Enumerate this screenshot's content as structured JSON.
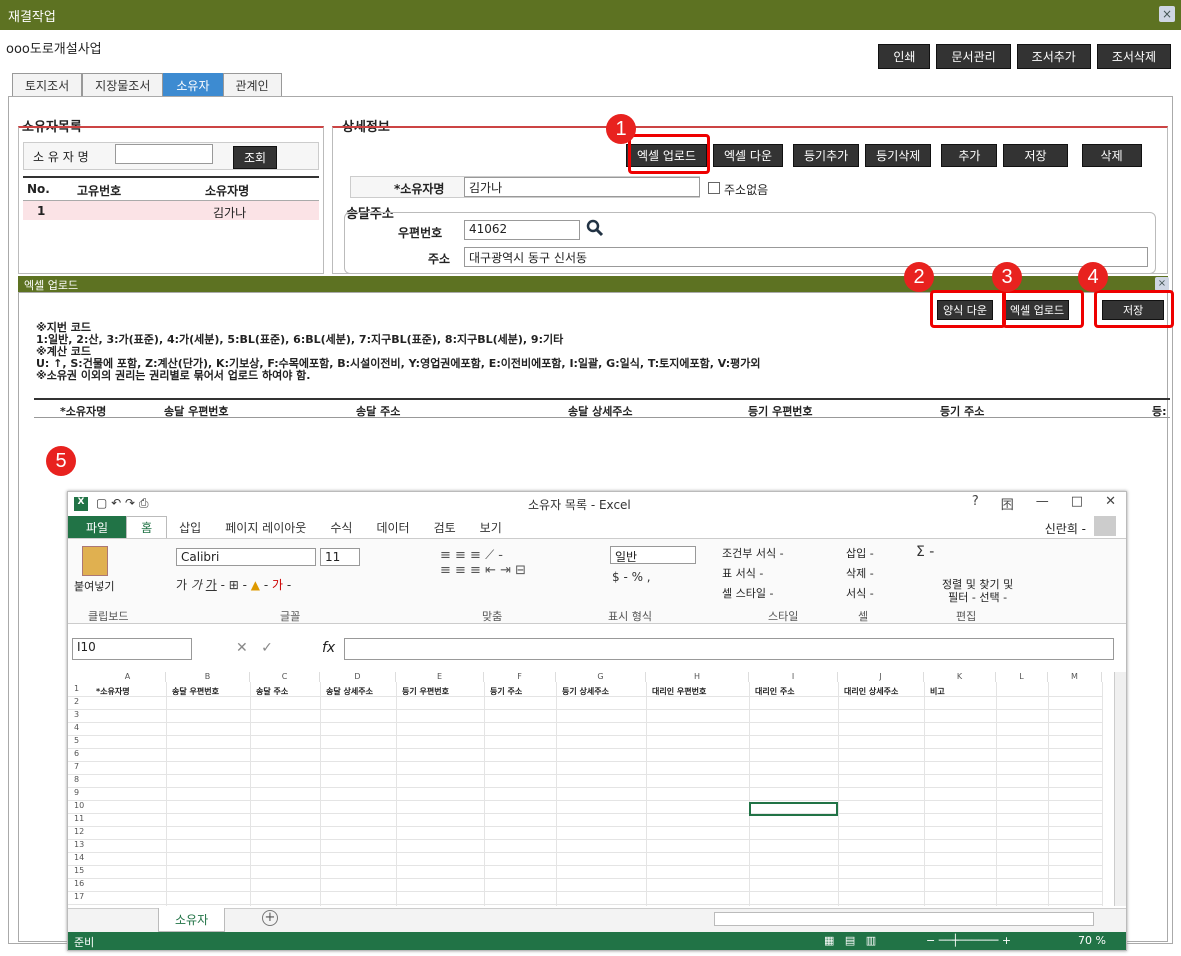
{
  "window": {
    "title": "재결작업",
    "close": "×"
  },
  "project": "ooo도로개설사업",
  "top_buttons": [
    "인쇄",
    "문서관리",
    "조서추가",
    "조서삭제"
  ],
  "tabs": [
    "토지조서",
    "지장물조서",
    "소유자",
    "관계인"
  ],
  "owner_list": {
    "title": "소유자목록",
    "search_label": "소 유 자 명",
    "search_value": "",
    "search_button": "조회",
    "columns": [
      "No.",
      "고유번호",
      "소유자명"
    ],
    "rows": [
      {
        "no": "1",
        "id": "",
        "name": "김가나"
      }
    ]
  },
  "detail": {
    "title": "상세정보",
    "buttons": [
      "엑셀 업로드",
      "엑셀 다운",
      "등기추가",
      "등기삭제",
      "추가",
      "저장",
      "삭제"
    ],
    "owner_label": "*소유자명",
    "owner_value": "김가나",
    "no_address": "주소없음",
    "delivery_title": "송달주소",
    "zip_label": "우편번호",
    "zip_value": "41062",
    "addr_label": "주소",
    "addr_value": "대구광역시 동구 신서동"
  },
  "markers": [
    "1",
    "2",
    "3",
    "4",
    "5"
  ],
  "excel_dialog": {
    "title": "엑셀 업로드",
    "buttons": [
      "양식 다운",
      "엑셀 업로드",
      "저장"
    ],
    "notes": [
      "※지번 코드",
      "1:일반, 2:산, 3:가(표준), 4:가(세분), 5:BL(표준), 6:BL(세분), 7:지구BL(표준), 8:지구BL(세분), 9:기타",
      "※계산 코드",
      "U: ↑, S:건물에 포함, Z:계산(단가), K:기보상, F:수목에포함, B:시설이전비, Y:영업권에포함, E:이전비에포함, I:일괄, G:일식, T:토지에포함, V:평가외",
      "※소유권 이외의 권리는 권리별로 묶어서 업로드 하여야 함."
    ],
    "columns": [
      "*소유자명",
      "송달 우편번호",
      "송달 주소",
      "송달 상세주소",
      "등기 우편번호",
      "등기 주소",
      "등:"
    ]
  },
  "excel": {
    "title": "소유자 목록 - Excel",
    "user": "신란희 -",
    "window_controls": [
      "?",
      "囨",
      "—",
      "□",
      "✕"
    ],
    "ribbon_tabs": [
      "파일",
      "홈",
      "삽입",
      "페이지 레이아웃",
      "수식",
      "데이터",
      "검토",
      "보기"
    ],
    "font": "Calibri",
    "font_size": "11",
    "number_format": "일반",
    "clipboard_paste": "붙여넣기",
    "ribbon_items": [
      "조건부 서식 -",
      "표 서식 -",
      "셀 스타일 -",
      "삽입 -",
      "삭제 -",
      "서식 -",
      "정렬 및 찾기 및",
      "필터 - 선택 -"
    ],
    "groups": [
      "클립보드",
      "글꼴",
      "맞춤",
      "표시 형식",
      "스타일",
      "셀",
      "편집"
    ],
    "name_box": "I10",
    "fx": "fx",
    "col_letters": [
      "A",
      "B",
      "C",
      "D",
      "E",
      "F",
      "G",
      "H",
      "I",
      "J",
      "K",
      "L",
      "M"
    ],
    "header_row": [
      "*소유자명",
      "송달 우편번호",
      "송달 주소",
      "송달 상세주소",
      "등기 우편번호",
      "등기 주소",
      "등기 상세주소",
      "대리인 우편번호",
      "대리인 주소",
      "대리인 상세주소",
      "비고"
    ],
    "row_numbers": [
      "1",
      "2",
      "3",
      "4",
      "5",
      "6",
      "7",
      "8",
      "9",
      "10",
      "11",
      "12",
      "13",
      "14",
      "15",
      "16",
      "17"
    ],
    "sheet_tab": "소유자",
    "status": "준비",
    "zoom": "70 %"
  }
}
